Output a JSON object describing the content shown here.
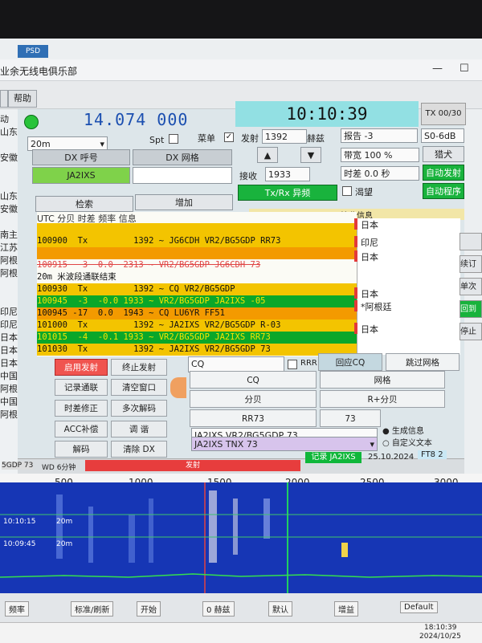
{
  "taskbar_icon_label": "PSD",
  "window_title": "业余无线电俱乐部",
  "menu": {
    "item_a": "",
    "help": "帮助"
  },
  "top": {
    "dial_frequency": "14.074  000",
    "clock": "10:10:39",
    "tx_count": "TX 00/30",
    "band": "20m",
    "spt_label": "Spt",
    "menu_label": "菜单",
    "menu_checked": "✓"
  },
  "dx": {
    "call_label": "DX 呼号",
    "grid_label": "DX 网格",
    "call_value": "JA2IXS",
    "grid_value": "",
    "search_label": "检索",
    "add_label": "增加"
  },
  "tx_controls": {
    "tx_label": "发射",
    "tx_freq": "1392",
    "hz_label": "赫兹",
    "rx_label": "接收",
    "rx_freq": "1933",
    "up_arrow": "▲",
    "down_arrow": "▼",
    "txrx_button": "Tx/Rx 异频",
    "hound_label": "渴望",
    "report_label": "报告 -3",
    "s0_label": "S0-6dB",
    "bandwidth_label": "带宽  100 %",
    "hunter_label": "猎犬",
    "time_offset_label": "时差  0.0 秒",
    "auto_tx_label": "自动发射",
    "auto_seq_label": "自动程序"
  },
  "decode_header": "UTC    分贝 时差 频率    信息",
  "rx_header": "接收信息",
  "decode_rows": [
    {
      "text": "",
      "bg": "#f3c400",
      "color": "#111"
    },
    {
      "text": "100900  Tx         1392 ~ JG6CDH VR2/BG5GDP RR73",
      "bg": "#f3c400",
      "color": "#111"
    },
    {
      "text": "",
      "bg": "#f39a00",
      "color": "#111"
    },
    {
      "text": "100915   3  0.0  2313 ~ VR2/BG5GDP JG6CDH 73",
      "bg": "#fbfbf5",
      "color": "#e04545"
    },
    {
      "text": "20m 米波段通联结束",
      "bg": "#fbfbf5",
      "color": "#111"
    },
    {
      "text": "100930  Tx         1392 ~ CQ VR2/BG5GDP",
      "bg": "#f3c400",
      "color": "#111"
    },
    {
      "text": "100945  -3  -0.0 1933 ~ VR2/BG5GDP JA2IXS -05",
      "bg": "#0aa72a",
      "color": "#f5e400"
    },
    {
      "text": "100945 -17  0.0  1943 ~ CQ LU6YR FF51",
      "bg": "#f39a00",
      "color": "#111"
    },
    {
      "text": "101000  Tx         1392 ~ JA2IXS VR2/BG5GDP R-03",
      "bg": "#f3c400",
      "color": "#111"
    },
    {
      "text": "101015  -4  -0.1 1933 ~ VR2/BG5GDP JA2IXS RR73",
      "bg": "#0aa72a",
      "color": "#f5e400"
    },
    {
      "text": "101030  Tx         1392 ~ JA2IXS VR2/BG5GDP 73",
      "bg": "#f3c400",
      "color": "#111"
    }
  ],
  "rx_rows": [
    {
      "text": "日本"
    },
    {
      "text": "印尼"
    },
    {
      "text": "日本"
    },
    {
      "text": "日本"
    },
    {
      "text": "*阿根廷"
    },
    {
      "text": "日本"
    }
  ],
  "left_list": [
    "动",
    "山东",
    "",
    "安徽",
    "",
    "",
    "山东",
    "安徽",
    "",
    "南主",
    "江苏",
    "阿根廷",
    "阿根廷",
    "",
    "",
    "印尼",
    "印尼",
    "日本",
    "日本",
    "日本",
    "中国 安徽",
    "阿根廷",
    "中国 山东",
    "阿根廷"
  ],
  "right_buttons": [
    "",
    "续订",
    "单次",
    "回到",
    "停止"
  ],
  "bottom_buttons": {
    "enable_tx": "启用发射",
    "stop_tx": "终止发射",
    "log_qso": "记录通联",
    "clear_window": "清空窗口",
    "time_correct": "时差修正",
    "multi_decode": "多次解码",
    "acc_correct": "ACC补偿",
    "tune": "调 谐",
    "decode": "解码",
    "clear_dx": "清除 DX"
  },
  "messages": {
    "cq_field": "CQ",
    "rrr": "RRR",
    "reply_cq": "回应CQ",
    "skip_grid": "跳过网格",
    "m1": "CQ",
    "m2": "网格",
    "m3": "分贝",
    "m4": "R+分贝",
    "m5": "RR73",
    "m6": "73",
    "next_msg": "JA2IXS VR2/BG5GDP 73",
    "tx_msg": "JA2IXS TNX 73",
    "generated": "生成信息",
    "custom": "自定义文本"
  },
  "status": {
    "left": "5GDP 73",
    "wd": "WD 6分钟",
    "tx_status": "发射",
    "logged": "记录 JA2IXS",
    "date": "25.10.2024",
    "ft8": "FT8  2"
  },
  "waterfall": {
    "scale_labels": [
      "500",
      "1000",
      "1500",
      "2000",
      "2500",
      "3000"
    ],
    "time_labels": [
      "10:10:15",
      "10:09:45"
    ],
    "band_label": "20m"
  },
  "wf_controls": [
    "频率",
    "标准/刷新",
    "开始",
    "0 赫兹",
    "默认",
    "增益",
    "Default"
  ],
  "taskbar": {
    "time": "18:10:39",
    "date": "2024/10/25"
  }
}
